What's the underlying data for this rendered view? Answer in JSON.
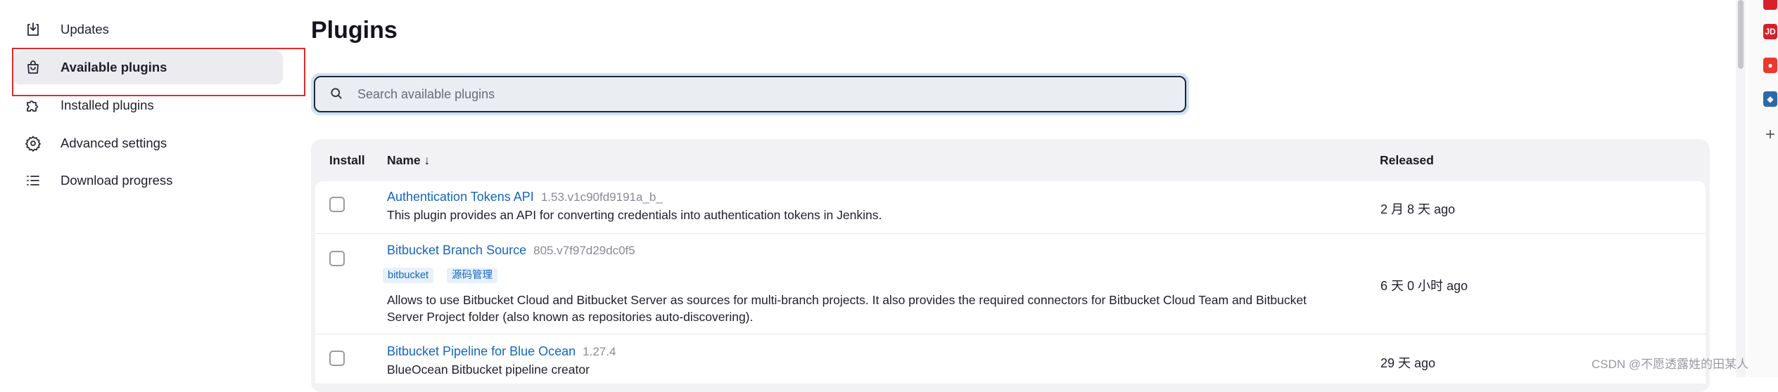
{
  "sidebar": {
    "items": [
      {
        "label": "Updates",
        "icon": "download-icon"
      },
      {
        "label": "Available plugins",
        "icon": "shopping-bag-icon",
        "active": true
      },
      {
        "label": "Installed plugins",
        "icon": "puzzle-icon"
      },
      {
        "label": "Advanced settings",
        "icon": "gear-icon"
      },
      {
        "label": "Download progress",
        "icon": "list-icon"
      }
    ]
  },
  "main": {
    "title": "Plugins",
    "search": {
      "placeholder": "Search available plugins",
      "value": ""
    },
    "table": {
      "headers": {
        "install": "Install",
        "name": "Name ↓",
        "released": "Released"
      },
      "rows": [
        {
          "name": "Authentication Tokens API",
          "version": "1.53.v1c90fd9191a_b_",
          "tags": [],
          "description": "This plugin provides an API for converting credentials into authentication tokens in Jenkins.",
          "released": "2 月 8 天 ago"
        },
        {
          "name": "Bitbucket Branch Source",
          "version": "805.v7f97d29dc0f5",
          "tags": [
            "bitbucket",
            "源码管理"
          ],
          "description_line1": "Allows to use Bitbucket Cloud and Bitbucket Server as sources for multi-branch projects. It also provides the required connectors for Bitbucket Cloud Team and Bitbucket",
          "description_line2": "Server Project folder (also known as repositories auto-discovering).",
          "released": "6 天 0 小时 ago"
        },
        {
          "name": "Bitbucket Pipeline for Blue Ocean",
          "version": "1.27.4",
          "tags": [],
          "description": "BlueOcean Bitbucket pipeline creator",
          "released": "29 天 ago"
        }
      ]
    }
  },
  "browser_sidebar": {
    "icons": [
      {
        "name": "jd-icon",
        "label": "JD",
        "color": "#d7202a"
      },
      {
        "name": "red-app-icon",
        "label": "",
        "color": "#e9392f"
      },
      {
        "name": "blue-app-icon",
        "label": "",
        "color": "#2a6aa8"
      },
      {
        "name": "plus-icon",
        "label": "+"
      }
    ]
  },
  "watermark": "CSDN @不愿透露姓的田某人",
  "colors": {
    "link": "#1466c1",
    "accent_focus": "#cfe2f7",
    "highlight_box": "#e02b2b",
    "active_bg": "#ebebf0"
  }
}
